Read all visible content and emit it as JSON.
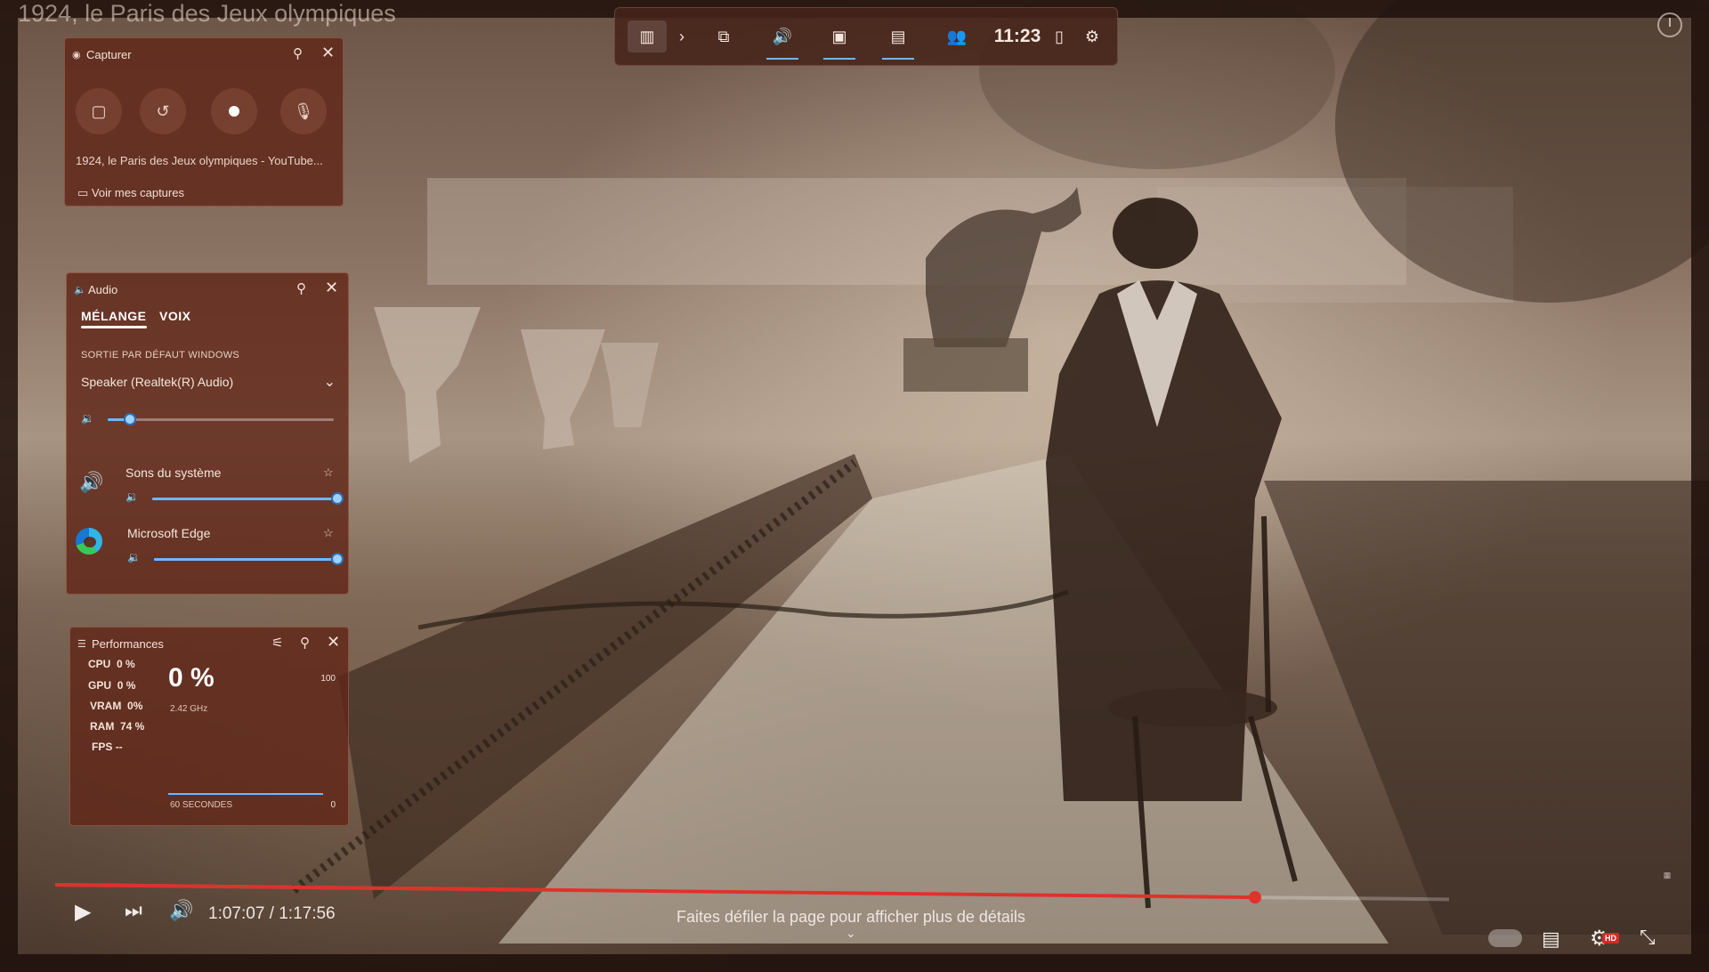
{
  "video": {
    "title": "1924, le Paris des Jeux olympiques"
  },
  "gamebar": {
    "time": "11:23",
    "items": [
      "widget-menu-icon",
      "chevron-right-icon",
      "capture-icon",
      "audio-icon",
      "performance-icon",
      "resources-icon",
      "xbox-social-icon",
      "mouse-icon",
      "settings-icon"
    ]
  },
  "capture": {
    "title": "Capturer",
    "source": "1924, le Paris des Jeux olympiques - YouTube...",
    "view_link": "Voir mes captures"
  },
  "audio": {
    "title": "Audio",
    "tab_mix": "MÉLANGE",
    "tab_voice": "VOIX",
    "output_label": "SORTIE PAR DÉFAUT WINDOWS",
    "device": "Speaker (Realtek(R) Audio)",
    "master_volume": 0.1,
    "apps": [
      {
        "name": "Sons du système",
        "volume": 1.0
      },
      {
        "name": "Microsoft Edge",
        "volume": 1.0
      }
    ]
  },
  "performance": {
    "title": "Performances",
    "rows": [
      {
        "label": "CPU",
        "value": "0 %"
      },
      {
        "label": "GPU",
        "value": "0 %"
      },
      {
        "label": "VRAM",
        "value": "0%"
      },
      {
        "label": "RAM",
        "value": "74 %"
      },
      {
        "label": "FPS",
        "value": "--"
      }
    ],
    "big_value": "0 %",
    "frequency": "2.42 GHz",
    "max": "100",
    "window": "60 SECONDES",
    "min": "0"
  },
  "player": {
    "time": "1:07:07 / 1:17:56",
    "progress": 0.861,
    "scroll_hint": "Faites défiler la page pour afficher plus de détails",
    "hd_badge": "HD"
  },
  "colors": {
    "panel": "#5f2619",
    "accent": "#6fb7ff",
    "progress": "#e0312b"
  }
}
